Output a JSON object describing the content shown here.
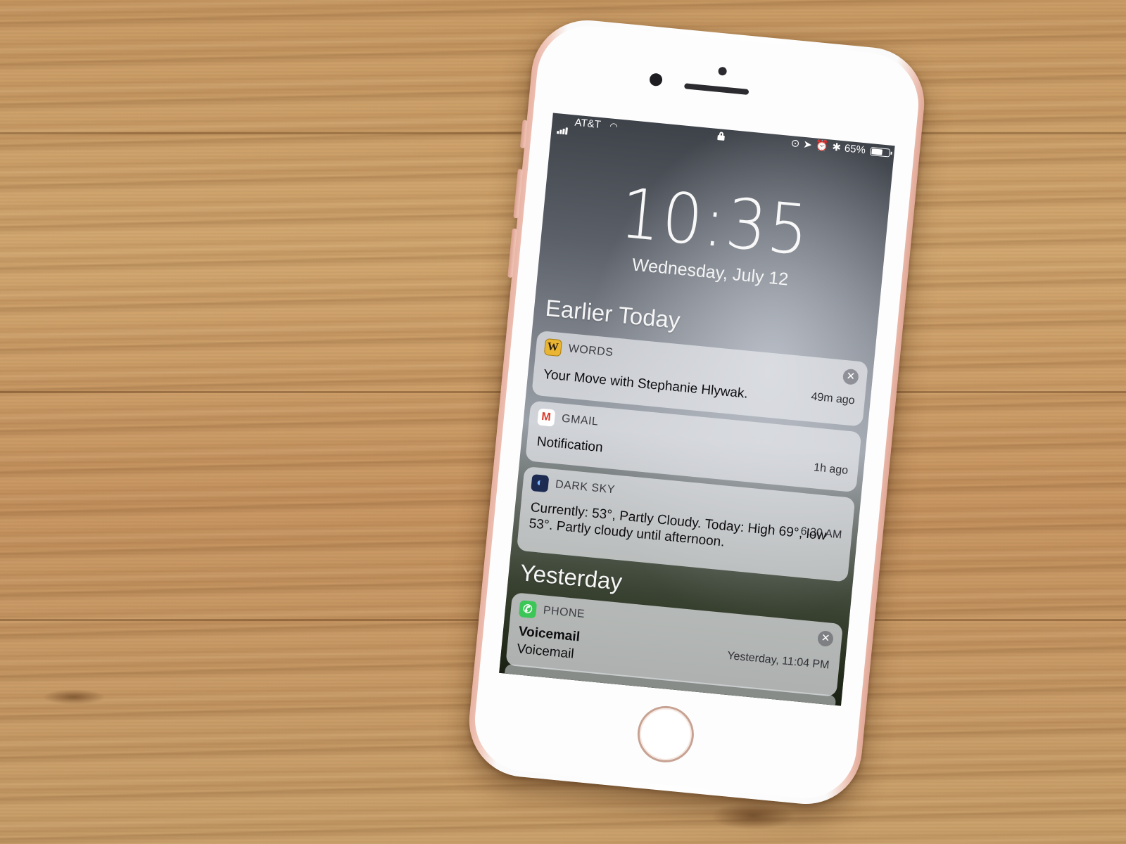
{
  "status_bar": {
    "carrier": "AT&T",
    "battery_percent": "65%",
    "battery_level": 0.65
  },
  "lock_screen": {
    "time": "10:35",
    "date": "Wednesday, July 12"
  },
  "sections": {
    "earlier_today": "Earlier Today",
    "yesterday": "Yesterday"
  },
  "notifications": {
    "words": {
      "app": "WORDS",
      "icon": "words-icon",
      "body": "Your Move with Stephanie Hlywak.",
      "time": "49m ago"
    },
    "gmail": {
      "app": "GMAIL",
      "icon": "gmail-icon",
      "body": "Notification",
      "time": "1h ago"
    },
    "darksky": {
      "app": "DARK SKY",
      "icon": "dark-sky-icon",
      "body": "Currently: 53°, Partly Cloudy. Today:  High 69°, low 53°. Partly cloudy until afternoon.",
      "time": "6:30 AM"
    },
    "phone": {
      "app": "PHONE",
      "icon": "phone-icon",
      "title": "Voicemail",
      "body": "Voicemail",
      "time": "Yesterday, 11:04 PM"
    }
  }
}
